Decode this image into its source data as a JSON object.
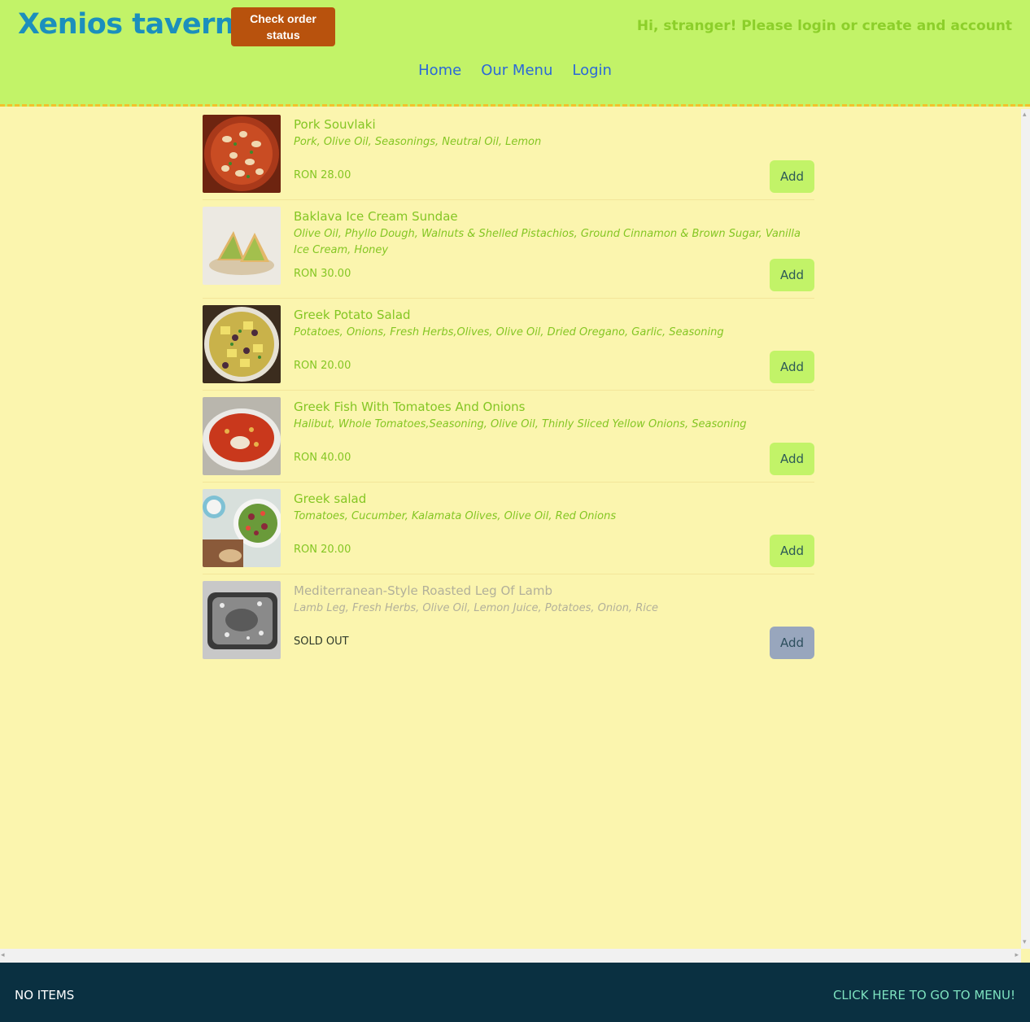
{
  "header": {
    "brand": "Xenios taverna",
    "order_status_label": "Check order status",
    "greeting": "Hi, stranger! Please login or create and account",
    "nav": [
      "Home",
      "Our Menu",
      "Login"
    ]
  },
  "menu": {
    "add_label": "Add",
    "items": [
      {
        "name": "Pork Souvlaki",
        "description": "Pork, Olive Oil, Seasonings, Neutral Oil, Lemon",
        "price": "RON 28.00",
        "image": "souvlaki-photo"
      },
      {
        "name": "Baklava Ice Cream Sundae",
        "description": "Olive Oil, Phyllo Dough, Walnuts & Shelled Pistachios, Ground Cinnamon & Brown Sugar, Vanilla Ice Cream, Honey",
        "price": "RON 30.00",
        "image": "baklava-photo"
      },
      {
        "name": "Greek Potato Salad",
        "description": "Potatoes, Onions, Fresh Herbs,Olives, Olive Oil, Dried Oregano, Garlic, Seasoning",
        "price": "RON 20.00",
        "image": "potato-salad-photo"
      },
      {
        "name": "Greek Fish With Tomatoes And Onions",
        "description": "Halibut, Whole Tomatoes,Seasoning, Olive Oil, Thinly Sliced Yellow Onions, Seasoning",
        "price": "RON 40.00",
        "image": "fish-stew-photo"
      },
      {
        "name": "Greek salad",
        "description": "Tomatoes, Cucumber, Kalamata Olives, Olive Oil, Red Onions",
        "price": "RON 20.00",
        "image": "greek-salad-photo"
      },
      {
        "name": "Mediterranean-Style Roasted Leg Of Lamb",
        "description": "Lamb Leg, Fresh Herbs, Olive Oil, Lemon Juice, Potatoes, Onion, Rice",
        "price": "SOLD OUT",
        "image": "lamb-photo"
      }
    ]
  },
  "footer": {
    "cart_status": "NO ITEMS",
    "menu_link": "CLICK HERE TO GO TO MENU!"
  }
}
